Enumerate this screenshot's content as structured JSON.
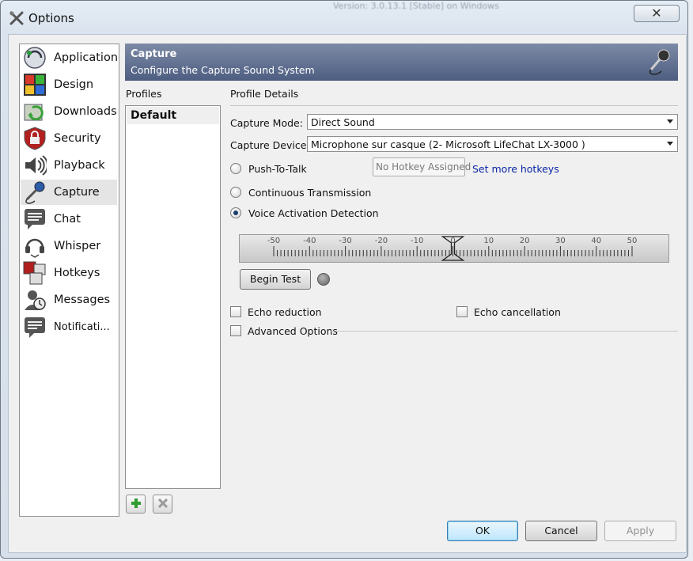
{
  "window": {
    "title": "Options",
    "close_glyph": "✕",
    "icon": "tools-icon",
    "behind_text": "Version: 3.0.13.1 [Stable] on Windows"
  },
  "sidebar": {
    "items": [
      {
        "label": "Application",
        "icon": "teamspeak-icon"
      },
      {
        "label": "Design",
        "icon": "palette-icon"
      },
      {
        "label": "Downloads",
        "icon": "downloads-icon"
      },
      {
        "label": "Security",
        "icon": "padlock-icon"
      },
      {
        "label": "Playback",
        "icon": "speaker-icon"
      },
      {
        "label": "Capture",
        "icon": "microphone-icon"
      },
      {
        "label": "Chat",
        "icon": "chat-icon"
      },
      {
        "label": "Whisper",
        "icon": "headset-icon"
      },
      {
        "label": "Hotkeys",
        "icon": "hotkeys-icon"
      },
      {
        "label": "Messages",
        "icon": "messages-icon"
      },
      {
        "label": "Notificati...",
        "icon": "notifications-icon"
      }
    ],
    "selected": "Capture"
  },
  "header": {
    "title": "Capture",
    "subtitle": "Configure the Capture Sound System",
    "icon": "microphone-icon"
  },
  "profiles": {
    "heading": "Profiles",
    "items": [
      "Default"
    ],
    "add_icon": "plus-icon",
    "remove_icon": "x-icon"
  },
  "details": {
    "heading": "Profile Details",
    "capture_mode_label": "Capture Mode:",
    "capture_mode_value": "Direct Sound",
    "capture_device_label": "Capture Device:",
    "capture_device_value": "Microphone sur casque (2- Microsoft LifeChat LX-3000 )",
    "push_to_talk": "Push-To-Talk",
    "hotkey_placeholder": "No Hotkey Assigned",
    "set_hotkeys": "Set more hotkeys",
    "continuous": "Continuous Transmission",
    "vad": "Voice Activation Detection",
    "mode_selected": "Voice Activation Detection",
    "slider_ticks": [
      "-50",
      "-40",
      "-30",
      "-20",
      "-10",
      "0",
      "10",
      "20",
      "30",
      "40",
      "50"
    ],
    "slider_value": 0,
    "begin_test": "Begin Test",
    "echo_reduction": "Echo reduction",
    "echo_cancellation": "Echo cancellation",
    "advanced": "Advanced Options"
  },
  "footer": {
    "ok": "OK",
    "cancel": "Cancel",
    "apply": "Apply"
  },
  "colors": {
    "header_top": "#7d8aa6",
    "header_bottom": "#4d5e81",
    "link": "#0a26a5",
    "selected_bg": "#e5e5e5"
  }
}
